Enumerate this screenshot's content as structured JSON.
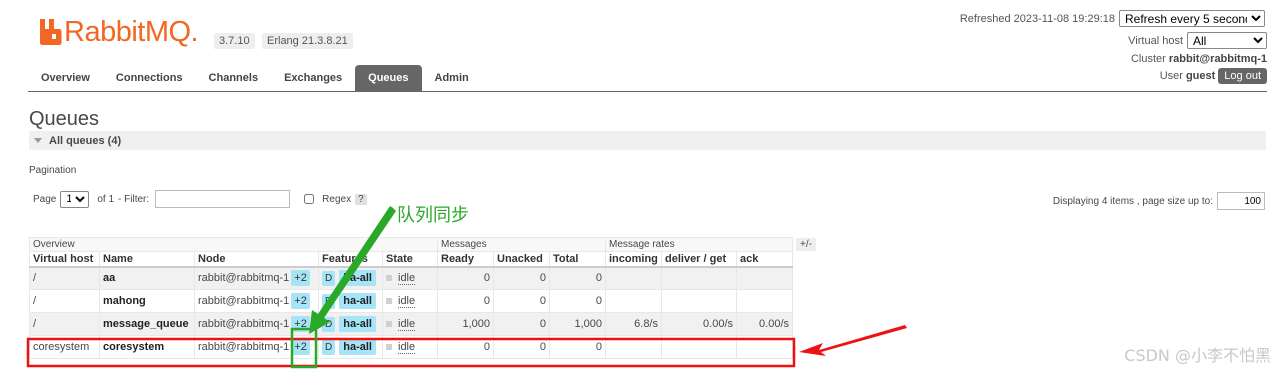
{
  "header": {
    "logo_text": "RabbitMQ.",
    "version": "3.7.10",
    "erlang": "Erlang 21.3.8.21",
    "refreshed_label": "Refreshed 2023-11-08 19:29:18",
    "refresh_select": "Refresh every 5 seconds",
    "virtual_host_label": "Virtual host",
    "virtual_host_value": "All",
    "cluster_label": "Cluster",
    "cluster_value": "rabbit@rabbitmq-1",
    "user_label": "User",
    "user_value": "guest",
    "logout_label": "Log out"
  },
  "tabs": [
    {
      "label": "Overview"
    },
    {
      "label": "Connections"
    },
    {
      "label": "Channels"
    },
    {
      "label": "Exchanges"
    },
    {
      "label": "Queues",
      "active": true
    },
    {
      "label": "Admin"
    }
  ],
  "page": {
    "title": "Queues",
    "section": "All queues (4)",
    "pagination_label": "Pagination",
    "page_label": "Page",
    "page_value": "1",
    "of_label": "of 1",
    "filter_label": "- Filter:",
    "filter_value": "",
    "regex_label": "Regex",
    "help": "?",
    "displaying_label": "Displaying 4 items , page size up to:",
    "page_size": "100",
    "plus_minus": "+/-"
  },
  "table": {
    "groups": {
      "overview": "Overview",
      "messages": "Messages",
      "rates": "Message rates"
    },
    "columns": [
      "Virtual host",
      "Name",
      "Node",
      "Features",
      "State",
      "Ready",
      "Unacked",
      "Total",
      "incoming",
      "deliver / get",
      "ack"
    ],
    "rows": [
      {
        "vhost": "/",
        "name": "aa",
        "node": "rabbit@rabbitmq-1",
        "plus": "+2",
        "d": "D",
        "ha": "ha-all",
        "state": "idle",
        "ready": "0",
        "unacked": "0",
        "total": "0",
        "incoming": "",
        "deliver": "",
        "ack": ""
      },
      {
        "vhost": "/",
        "name": "mahong",
        "node": "rabbit@rabbitmq-1",
        "plus": "+2",
        "d": "D",
        "ha": "ha-all",
        "state": "idle",
        "ready": "0",
        "unacked": "0",
        "total": "0",
        "incoming": "",
        "deliver": "",
        "ack": ""
      },
      {
        "vhost": "/",
        "name": "message_queue",
        "node": "rabbit@rabbitmq-1",
        "plus": "+2",
        "d": "D",
        "ha": "ha-all",
        "state": "idle",
        "ready": "1,000",
        "unacked": "0",
        "total": "1,000",
        "incoming": "6.8/s",
        "deliver": "0.00/s",
        "ack": "0.00/s"
      },
      {
        "vhost": "coresystem",
        "name": "coresystem",
        "node": "rabbit@rabbitmq-1",
        "plus": "+2",
        "d": "D",
        "ha": "ha-all",
        "state": "idle",
        "ready": "0",
        "unacked": "0",
        "total": "0",
        "incoming": "",
        "deliver": "",
        "ack": ""
      }
    ]
  },
  "annotation": {
    "text": "队列同步",
    "green": "#2aa82a",
    "red": "#ee1111"
  },
  "watermark": "CSDN @小李不怕黑",
  "colors": {
    "brand": "#f16723",
    "tab_active": "#666666",
    "feature_badge": "#a6e5f7"
  }
}
